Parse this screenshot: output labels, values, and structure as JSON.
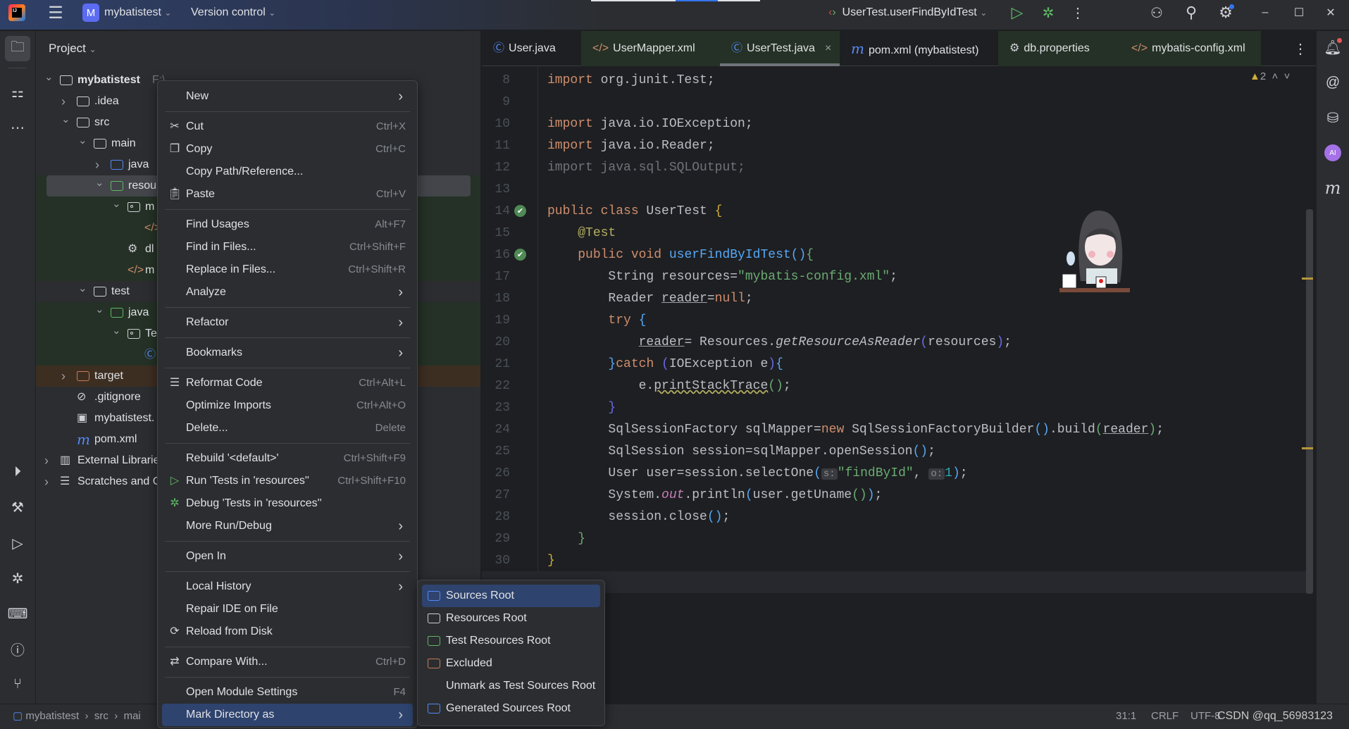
{
  "titlebar": {
    "project_badge": "M",
    "project_name": "mybatistest",
    "vcs": "Version control",
    "run_config": "UserTest.userFindByIdTest",
    "icons": [
      "app-logo",
      "hamburger-menu",
      "run",
      "debug",
      "more-vertical",
      "add-user",
      "search",
      "settings",
      "minimize",
      "maximize",
      "close"
    ]
  },
  "left_strip": {
    "top": [
      "folder-icon",
      "structure-icon",
      "more-icon"
    ],
    "bottom": [
      "services-icon",
      "build-icon",
      "run-icon",
      "debug-icon",
      "terminal-icon",
      "problems-icon",
      "git-icon"
    ]
  },
  "right_strip": [
    "notifications-icon",
    "ai-spiral-icon",
    "database-icon",
    "ai-assistant-icon",
    "maven-icon"
  ],
  "project": {
    "header": "Project",
    "tree": [
      {
        "label": "mybatistest",
        "suffix": "F:\\",
        "depth": 0,
        "chev": "down",
        "icon": "module"
      },
      {
        "label": ".idea",
        "depth": 1,
        "chev": "right",
        "icon": "folder"
      },
      {
        "label": "src",
        "depth": 1,
        "chev": "down",
        "icon": "folder"
      },
      {
        "label": "main",
        "depth": 2,
        "chev": "down",
        "icon": "folder"
      },
      {
        "label": "java",
        "depth": 3,
        "chev": "right",
        "icon": "folder-blue"
      },
      {
        "label": "resou",
        "depth": 3,
        "chev": "down",
        "icon": "folder-green",
        "bg": "sel"
      },
      {
        "label": "m",
        "depth": 4,
        "chev": "down",
        "icon": "package",
        "bg": "green"
      },
      {
        "label": "",
        "depth": 5,
        "icon": "xml",
        "bg": "green"
      },
      {
        "label": "dl",
        "depth": 4,
        "icon": "gear",
        "bg": "green"
      },
      {
        "label": "m",
        "depth": 4,
        "icon": "xml",
        "bg": "green"
      },
      {
        "label": "test",
        "depth": 2,
        "chev": "down",
        "icon": "folder"
      },
      {
        "label": "java",
        "depth": 3,
        "chev": "down",
        "icon": "folder-green",
        "bg": "green"
      },
      {
        "label": "Te",
        "depth": 4,
        "chev": "down",
        "icon": "package",
        "bg": "green"
      },
      {
        "label": "",
        "depth": 5,
        "icon": "class",
        "bg": "green"
      },
      {
        "label": "target",
        "depth": 1,
        "chev": "right",
        "icon": "folder-orange",
        "bg": "orange"
      },
      {
        "label": ".gitignore",
        "depth": 1,
        "icon": "ignore"
      },
      {
        "label": "mybatistest.",
        "depth": 1,
        "icon": "iml"
      },
      {
        "label": "pom.xml",
        "depth": 1,
        "icon": "maven"
      },
      {
        "label": "External Librarie",
        "depth": 0,
        "chev": "right",
        "icon": "library"
      },
      {
        "label": "Scratches and C",
        "depth": 0,
        "chev": "right",
        "icon": "scratch"
      }
    ]
  },
  "tabs": [
    {
      "label": "User.java",
      "icon": "class",
      "style": ""
    },
    {
      "label": "UserMapper.xml",
      "icon": "xml",
      "style": "green"
    },
    {
      "label": "UserTest.java",
      "icon": "class",
      "style": "active",
      "close": "×"
    },
    {
      "label": "pom.xml (mybatistest)",
      "icon": "maven",
      "style": ""
    },
    {
      "label": "db.properties",
      "icon": "gear",
      "style": "green"
    },
    {
      "label": "mybatis-config.xml",
      "icon": "xml",
      "style": "green"
    }
  ],
  "editor": {
    "warning_count": "2",
    "lines": [
      {
        "n": "8",
        "t": [
          [
            "kw",
            "import"
          ],
          [
            "",
            " org.junit.Test;"
          ]
        ]
      },
      {
        "n": "9",
        "t": []
      },
      {
        "n": "10",
        "t": [
          [
            "kw",
            "import"
          ],
          [
            "",
            " java.io.IOException;"
          ]
        ]
      },
      {
        "n": "11",
        "t": [
          [
            "kw",
            "import"
          ],
          [
            "",
            " java.io.Reader;"
          ]
        ]
      },
      {
        "n": "12",
        "t": [
          [
            "gray",
            "import java.sql.SQLOutput;"
          ]
        ]
      },
      {
        "n": "13",
        "t": []
      },
      {
        "n": "14",
        "run": true,
        "t": [
          [
            "kw",
            "public class"
          ],
          [
            "",
            " UserTest "
          ],
          [
            "p1",
            "{"
          ]
        ]
      },
      {
        "n": "15",
        "t": [
          [
            "",
            "    "
          ],
          [
            "ann",
            "@Test"
          ]
        ]
      },
      {
        "n": "16",
        "run": true,
        "t": [
          [
            "",
            "    "
          ],
          [
            "kw",
            "public void "
          ],
          [
            "fn",
            "userFindByIdTest"
          ],
          [
            "p2",
            "()"
          ],
          [
            "p3",
            "{"
          ]
        ]
      },
      {
        "n": "17",
        "t": [
          [
            "",
            "        String resources="
          ],
          [
            "str",
            "\"mybatis-config.xml\""
          ],
          [
            "",
            ";"
          ]
        ]
      },
      {
        "n": "18",
        "t": [
          [
            "",
            "        Reader "
          ],
          [
            "ul",
            "reader"
          ],
          [
            "",
            "="
          ],
          [
            "kw",
            "null"
          ],
          [
            "",
            ";"
          ]
        ]
      },
      {
        "n": "19",
        "t": [
          [
            "",
            "        "
          ],
          [
            "kw",
            "try "
          ],
          [
            "p2",
            "{"
          ]
        ]
      },
      {
        "n": "20",
        "t": [
          [
            "",
            "            "
          ],
          [
            "ul",
            "reader"
          ],
          [
            "",
            "= Resources."
          ],
          [
            "it",
            "getResourceAsReader"
          ],
          [
            "p4",
            "("
          ],
          [
            "",
            "resources"
          ],
          [
            "p4",
            ")"
          ],
          [
            "",
            ";"
          ]
        ]
      },
      {
        "n": "21",
        "t": [
          [
            "",
            "        "
          ],
          [
            "p2",
            "}"
          ],
          [
            "kw",
            "catch "
          ],
          [
            "p4",
            "("
          ],
          [
            "",
            "IOException e"
          ],
          [
            "p4",
            ")"
          ],
          [
            "p2",
            "{"
          ]
        ]
      },
      {
        "n": "22",
        "t": [
          [
            "",
            "            e."
          ],
          [
            "wavy",
            "printStackTrace"
          ],
          [
            "p3",
            "()"
          ],
          [
            "",
            ";"
          ]
        ]
      },
      {
        "n": "23",
        "t": [
          [
            "",
            "        "
          ],
          [
            "p4",
            "}"
          ]
        ]
      },
      {
        "n": "24",
        "t": [
          [
            "",
            "        SqlSessionFactory sqlMapper="
          ],
          [
            "kw",
            "new"
          ],
          [
            "",
            " SqlSessionFactoryBuilder"
          ],
          [
            "p2",
            "()"
          ],
          [
            "",
            ".build"
          ],
          [
            "p3",
            "("
          ],
          [
            "ul",
            "reader"
          ],
          [
            "p3",
            ")"
          ],
          [
            "",
            ";"
          ]
        ]
      },
      {
        "n": "25",
        "t": [
          [
            "",
            "        SqlSession session=sqlMapper.openSession"
          ],
          [
            "p2",
            "()"
          ],
          [
            "",
            ";"
          ]
        ]
      },
      {
        "n": "26",
        "t": [
          [
            "",
            "        User user=session.selectOne"
          ],
          [
            "p2",
            "("
          ],
          [
            "hint",
            "s:"
          ],
          [
            "str",
            "\"findById\""
          ],
          [
            "",
            ", "
          ],
          [
            "hint",
            "o:"
          ],
          [
            "num",
            "1"
          ],
          [
            "p2",
            ")"
          ],
          [
            "",
            ";"
          ]
        ]
      },
      {
        "n": "27",
        "t": [
          [
            "",
            "        System."
          ],
          [
            "stat",
            "out"
          ],
          [
            "",
            ".println"
          ],
          [
            "p2",
            "("
          ],
          [
            "",
            "user.getUname"
          ],
          [
            "p3",
            "()"
          ],
          [
            "p2",
            ")"
          ],
          [
            "",
            ";"
          ]
        ]
      },
      {
        "n": "28",
        "t": [
          [
            "",
            "        session.close"
          ],
          [
            "p2",
            "()"
          ],
          [
            "",
            ";"
          ]
        ]
      },
      {
        "n": "29",
        "t": [
          [
            "",
            "    "
          ],
          [
            "p3",
            "}"
          ]
        ]
      },
      {
        "n": "30",
        "t": [
          [
            "p1",
            "}"
          ]
        ]
      }
    ]
  },
  "context_menu": [
    {
      "label": "New",
      "arrow": true
    },
    {
      "sep": true
    },
    {
      "label": "Cut",
      "short": "Ctrl+X",
      "icon": "✂",
      "iname": "scissors-icon"
    },
    {
      "label": "Copy",
      "short": "Ctrl+C",
      "icon": "❐",
      "iname": "copy-icon"
    },
    {
      "label": "Copy Path/Reference..."
    },
    {
      "label": "Paste",
      "short": "Ctrl+V",
      "icon": "📋︎",
      "iname": "clipboard-icon"
    },
    {
      "sep": true
    },
    {
      "label": "Find Usages",
      "short": "Alt+F7"
    },
    {
      "label": "Find in Files...",
      "short": "Ctrl+Shift+F"
    },
    {
      "label": "Replace in Files...",
      "short": "Ctrl+Shift+R"
    },
    {
      "label": "Analyze",
      "arrow": true
    },
    {
      "sep": true
    },
    {
      "label": "Refactor",
      "arrow": true
    },
    {
      "sep": true
    },
    {
      "label": "Bookmarks",
      "arrow": true
    },
    {
      "sep": true
    },
    {
      "label": "Reformat Code",
      "short": "Ctrl+Alt+L",
      "icon": "☰",
      "iname": "reformat-icon"
    },
    {
      "label": "Optimize Imports",
      "short": "Ctrl+Alt+O"
    },
    {
      "label": "Delete...",
      "short": "Delete"
    },
    {
      "sep": true
    },
    {
      "label": "Rebuild '<default>'",
      "short": "Ctrl+Shift+F9"
    },
    {
      "label": "Run 'Tests in 'resources''",
      "short": "Ctrl+Shift+F10",
      "icon": "▷",
      "iname": "run-icon",
      "icolor": "#5fb865"
    },
    {
      "label": "Debug 'Tests in 'resources''",
      "icon": "✲",
      "iname": "debug-icon",
      "icolor": "#5fb865"
    },
    {
      "label": "More Run/Debug",
      "arrow": true
    },
    {
      "sep": true
    },
    {
      "label": "Open In",
      "arrow": true
    },
    {
      "sep": true
    },
    {
      "label": "Local History",
      "arrow": true
    },
    {
      "label": "Repair IDE on File"
    },
    {
      "label": "Reload from Disk",
      "icon": "⟳",
      "iname": "reload-icon"
    },
    {
      "sep": true
    },
    {
      "label": "Compare With...",
      "short": "Ctrl+D",
      "icon": "⇄",
      "iname": "compare-icon"
    },
    {
      "sep": true
    },
    {
      "label": "Open Module Settings",
      "short": "F4"
    },
    {
      "label": "Mark Directory as",
      "arrow": true,
      "selected": true
    }
  ],
  "submenu": [
    {
      "label": "Sources Root",
      "icon": "folder-blue",
      "selected": true
    },
    {
      "label": "Resources Root",
      "icon": "folder-resources"
    },
    {
      "label": "Test Resources Root",
      "icon": "folder-test-resources"
    },
    {
      "label": "Excluded",
      "icon": "folder-orange"
    },
    {
      "label": "Unmark as Test Sources Root",
      "icon": ""
    },
    {
      "label": "Generated Sources Root",
      "icon": "folder-generated"
    }
  ],
  "statusbar": {
    "breadcrumb": [
      "mybatistest",
      "src",
      "mai"
    ],
    "position": "31:1",
    "line_sep": "CRLF",
    "encoding": "UTF-8",
    "watermark": "CSDN @qq_56983123"
  },
  "colors": {
    "accent": "#2e436e",
    "keyword": "#cf8e6d",
    "string": "#6aab73",
    "function": "#56a8f5"
  }
}
